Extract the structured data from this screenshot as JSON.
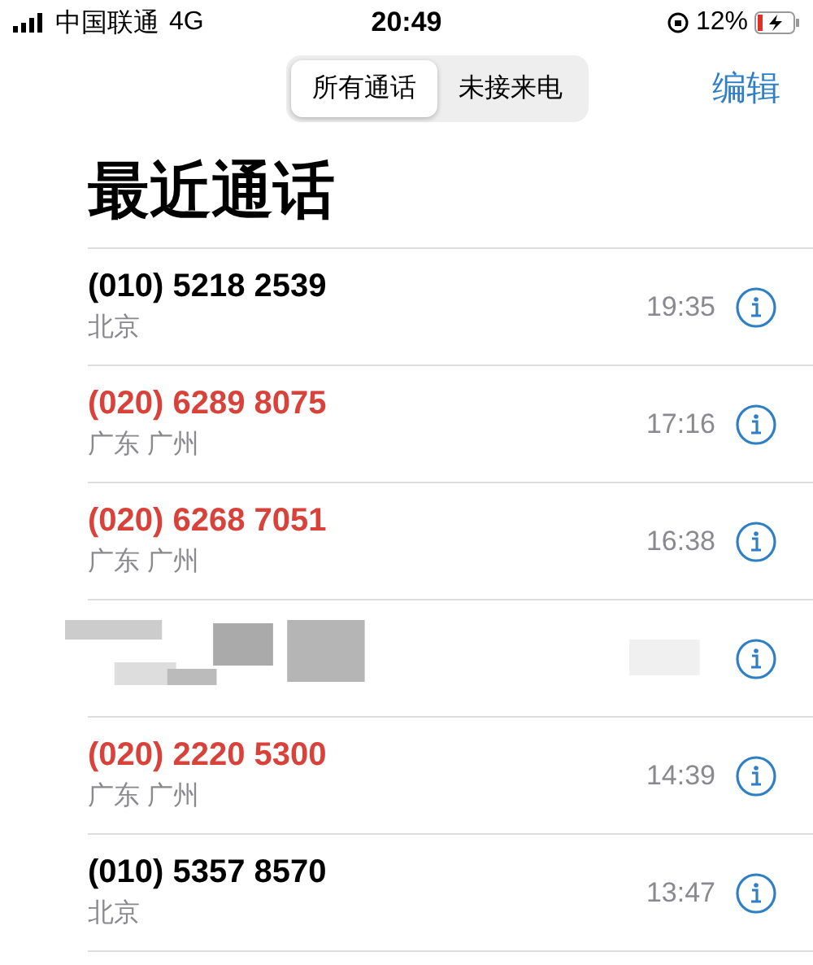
{
  "status_bar": {
    "carrier": "中国联通",
    "network": "4G",
    "time": "20:49",
    "battery": "12%"
  },
  "segments": [
    {
      "label": "所有通话",
      "selected": true
    },
    {
      "label": "未接来电",
      "selected": false
    }
  ],
  "edit_button": "编辑",
  "title": "最近通话",
  "calls": [
    {
      "kind": "call",
      "number": "(010) 5218 2539",
      "location": "北京",
      "time": "19:35",
      "missed": false
    },
    {
      "kind": "call",
      "number": "(020) 6289 8075",
      "location": "广东 广州",
      "time": "17:16",
      "missed": true
    },
    {
      "kind": "call",
      "number": "(020) 6268 7051",
      "location": "广东 广州",
      "time": "16:38",
      "missed": true
    },
    {
      "kind": "redacted"
    },
    {
      "kind": "call",
      "number": "(020) 2220 5300",
      "location": "广东 广州",
      "time": "14:39",
      "missed": true
    },
    {
      "kind": "call",
      "number": "(010) 5357 8570",
      "location": "北京",
      "time": "13:47",
      "missed": false
    }
  ]
}
